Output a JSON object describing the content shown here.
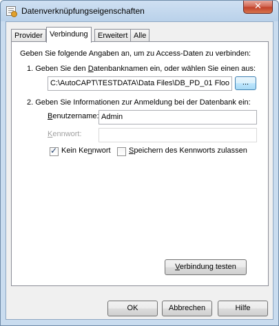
{
  "window": {
    "title": "Datenverknüpfungseigenschaften",
    "icon": "data-link-properties-icon",
    "close_label": "✕"
  },
  "tabs": [
    {
      "label": "Provider",
      "active": false
    },
    {
      "label": "Verbindung",
      "active": true
    },
    {
      "label": "Erweitert",
      "active": false
    },
    {
      "label": "Alle",
      "active": false
    }
  ],
  "connection": {
    "intro": "Geben Sie folgende Angaben an, um zu Access-Daten zu verbinden:",
    "step1": {
      "pre": "1. Geben Sie den ",
      "accel": "D",
      "post": "atenbanknamen ein, oder wählen Sie einen aus:"
    },
    "database_path": "C:\\AutoCAPT\\TESTDATA\\Data Files\\DB_PD_01 Floo",
    "browse_label": "...",
    "step2": "2. Geben Sie Informationen zur Anmeldung bei der Datenbank ein:",
    "username_label": {
      "pre": "",
      "accel": "B",
      "post": "enutzername:"
    },
    "username_value": "Admin",
    "password_label": {
      "pre": "",
      "accel": "K",
      "post": "ennwort:"
    },
    "password_value": "",
    "no_password": {
      "pre": "Kein Ke",
      "accel": "n",
      "post": "nwort",
      "checked": true
    },
    "save_password": {
      "pre": "",
      "accel": "S",
      "post": "peichern des Kennworts zulassen",
      "checked": false
    },
    "test_button": {
      "pre": "",
      "accel": "V",
      "post": "erbindung testen"
    }
  },
  "footer": {
    "ok": "OK",
    "cancel": "Abbrechen",
    "help": "Hilfe"
  }
}
